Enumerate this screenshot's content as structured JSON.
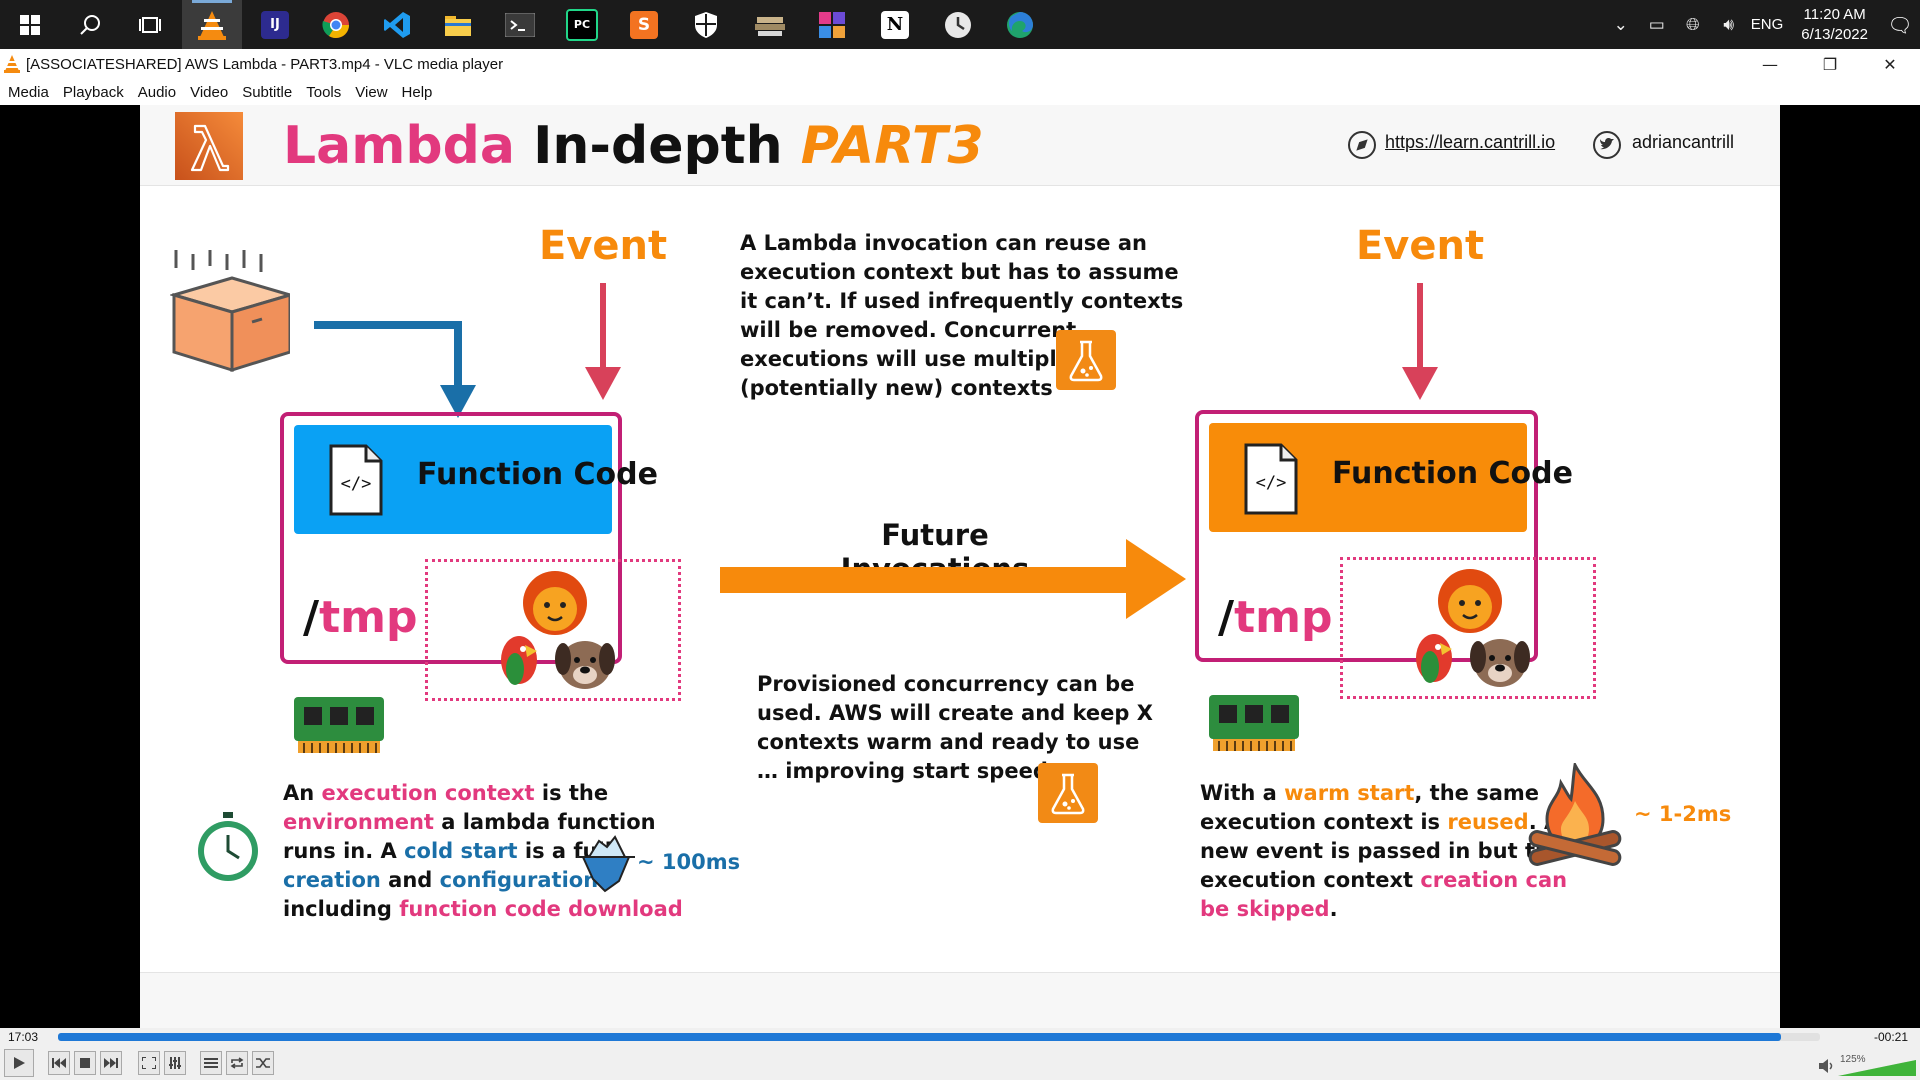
{
  "taskbar": {
    "apps": [
      "windows-start",
      "search",
      "task-view",
      "vlc",
      "intellij",
      "chrome",
      "vscode",
      "file-explorer",
      "terminal",
      "pycharm",
      "sublime-text",
      "security",
      "app-stack",
      "app-grid",
      "notion",
      "clock-app",
      "edge"
    ],
    "tray": {
      "lang": "ENG",
      "time": "11:20 AM",
      "date": "6/13/2022"
    }
  },
  "window": {
    "title": "[ASSOCIATESHARED] AWS Lambda - PART3.mp4 - VLC media player",
    "minimize": "—",
    "restore": "❐",
    "close": "✕"
  },
  "menu": [
    "Media",
    "Playback",
    "Audio",
    "Video",
    "Subtitle",
    "Tools",
    "View",
    "Help"
  ],
  "slide": {
    "title_part1": "Lambda",
    "title_part2": "In-depth",
    "title_part3": "PART3",
    "link": "https://learn.cantrill.io",
    "twitter": "adriancantrill",
    "event_left": "Event",
    "event_right": "Event",
    "function_code": "Function Code",
    "tmp": "/tmp",
    "tmp_slash": "/",
    "tmp_word": "tmp",
    "top_text": [
      "A Lambda invocation can reuse an",
      "execution context but has to assume",
      "it can’t. If used infrequently contexts",
      "will be removed. Concurrent",
      "executions will use multiple",
      "(potentially new) contexts"
    ],
    "future_invocations": "Future Invocations",
    "provisioned_text": [
      "Provisioned concurrency can be",
      "used. AWS will create and keep X",
      "contexts warm and ready to use",
      "… improving start speeds"
    ],
    "cold": {
      "p1": "An ",
      "p2": "execution context",
      "p3": " is the",
      "p4": "environment",
      "p5": " a lambda function",
      "p6": "runs in. A ",
      "p7": "cold start",
      "p8": " is a full",
      "p9": "creation",
      "p10": " and ",
      "p11": "configuration",
      "p12": "including ",
      "p13": "function code download",
      "timing": "~ 100ms"
    },
    "warm": {
      "p1": "With a ",
      "p2": "warm start",
      "p3": ", the same",
      "p4": "execution context is ",
      "p5": "reused",
      "p6": ". A",
      "p7": "new event is passed in but the",
      "p8": "execution context ",
      "p9": "creation can",
      "p10": "be skipped",
      "p11": ".",
      "timing": "~ 1-2ms"
    }
  },
  "player": {
    "elapsed": "17:03",
    "remaining": "-00:21",
    "progress": 0.978,
    "volume": "125%",
    "volume_level": 1.25
  },
  "colors": {
    "pink": "#e2397e",
    "orange": "#f78a0c",
    "blue": "#1a6fa8",
    "seek": "#1e78d6"
  }
}
